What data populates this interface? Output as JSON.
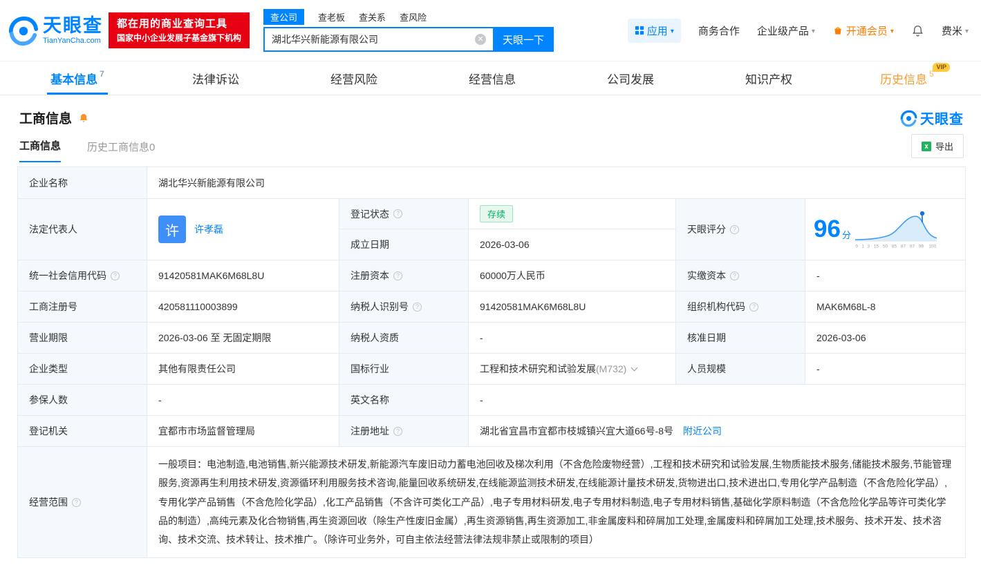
{
  "brand": {
    "name": "天眼查",
    "domain": "TianYanCha.com"
  },
  "colors": {
    "brand_blue": "#0084ff",
    "slogan_red": "#e60012",
    "status_green": "#00b365",
    "vip_orange": "#ff7d00",
    "history_orange": "#ff9a2e"
  },
  "header": {
    "slogan": {
      "line1": "都在用的商业查询工具",
      "line2": "国家中小企业发展子基金旗下机构"
    },
    "search": {
      "tabs": [
        {
          "label": "查公司",
          "active": true
        },
        {
          "label": "查老板",
          "active": false
        },
        {
          "label": "查关系",
          "active": false
        },
        {
          "label": "查风险",
          "active": false
        }
      ],
      "value": "湖北华兴新能源有限公司",
      "button_label": "天眼一下"
    },
    "nav": {
      "apps": "应用",
      "cooperation": "商务合作",
      "enterprise": "企业级产品",
      "vip": "开通会员",
      "user": "费米"
    }
  },
  "nav_tabs": [
    {
      "label": "基本信息",
      "count": "7"
    },
    {
      "label": "法律诉讼"
    },
    {
      "label": "经营风险"
    },
    {
      "label": "经营信息"
    },
    {
      "label": "公司发展"
    },
    {
      "label": "知识产权"
    },
    {
      "label": "历史信息",
      "count": "5",
      "badge": "VIP"
    }
  ],
  "section": {
    "title": "工商信息",
    "subtab_active": "工商信息",
    "subtab_history": "历史工商信息",
    "subtab_history_count": "0",
    "export_label": "导出"
  },
  "info": {
    "company_name_label": "企业名称",
    "company_name": "湖北华兴新能源有限公司",
    "legal_rep_label": "法定代表人",
    "legal_rep_avatar": "许",
    "legal_rep_name": "许孝磊",
    "reg_status_label": "登记状态",
    "reg_status_value": "存续",
    "establish_label": "成立日期",
    "establish_value": "2026-03-06",
    "score_label": "天眼评分",
    "score_value": "96",
    "score_unit": "分",
    "credit_code_label": "统一社会信用代码",
    "credit_code_value": "91420581MAK6M68L8U",
    "reg_capital_label": "注册资本",
    "reg_capital_value": "60000万人民币",
    "paid_capital_label": "实缴资本",
    "paid_capital_value": "-",
    "reg_number_label": "工商注册号",
    "reg_number_value": "420581110003899",
    "taxpayer_id_label": "纳税人识别号",
    "taxpayer_id_value": "91420581MAK6M68L8U",
    "org_code_label": "组织机构代码",
    "org_code_value": "MAK6M68L-8",
    "business_term_label": "营业期限",
    "business_term_value": "2026-03-06 至 无固定期限",
    "taxpayer_quality_label": "纳税人资质",
    "taxpayer_quality_value": "-",
    "approval_date_label": "核准日期",
    "approval_date_value": "2026-03-06",
    "company_type_label": "企业类型",
    "company_type_value": "其他有限责任公司",
    "industry_label": "国标行业",
    "industry_value": "工程和技术研究和试验发展",
    "industry_code": "(M732)",
    "staff_size_label": "人员规模",
    "staff_size_value": "-",
    "insured_label": "参保人数",
    "insured_value": "-",
    "english_name_label": "英文名称",
    "english_name_value": "-",
    "reg_authority_label": "登记机关",
    "reg_authority_value": "宜都市市场监督管理局",
    "address_label": "注册地址",
    "address_value": "湖北省宜昌市宜都市枝城镇兴宜大道66号-8号",
    "nearby_link": "附近公司",
    "business_scope_label": "经营范围",
    "business_scope_value": "一般项目：电池制造,电池销售,新兴能源技术研发,新能源汽车废旧动力蓄电池回收及梯次利用（不含危险废物经营）,工程和技术研究和试验发展,生物质能技术服务,储能技术服务,节能管理服务,资源再生利用技术研发,资源循环利用服务技术咨询,能量回收系统研发,在线能源监测技术研发,在线能源计量技术研发,货物进出口,技术进出口,专用化学产品制造（不含危险化学品）,专用化学产品销售（不含危险化学品）,化工产品销售（不含许可类化工产品）,电子专用材料研发,电子专用材料制造,电子专用材料销售,基础化学原料制造（不含危险化学品等许可类化学品的制造）,高纯元素及化合物销售,再生资源回收（除生产性废旧金属）,再生资源销售,再生资源加工,非金属废料和碎屑加工处理,金属废料和碎屑加工处理,技术服务、技术开发、技术咨询、技术交流、技术转让、技术推广。（除许可业务外，可自主依法经营法律法规非禁止或限制的项目）"
  },
  "score_chart": {
    "type": "area",
    "ticks": [
      "0",
      "1",
      "3",
      "15",
      "50",
      "85",
      "87",
      "97",
      "99",
      "100"
    ],
    "score": 96
  }
}
